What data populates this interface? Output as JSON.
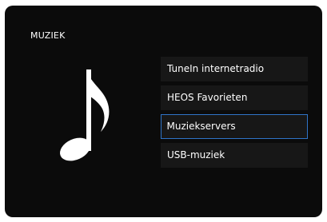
{
  "screen": {
    "title": "MUZIEK",
    "icon": "music-note-icon"
  },
  "menu": {
    "items": [
      {
        "label": "TuneIn internetradio"
      },
      {
        "label": "HEOS Favorieten"
      },
      {
        "label": "Muziekservers",
        "selected": true
      },
      {
        "label": "USB-muziek"
      }
    ]
  },
  "colors": {
    "background": "#0b0b0b",
    "item_background": "#171717",
    "text": "#ffffff",
    "selection_border": "#2f74c8"
  }
}
